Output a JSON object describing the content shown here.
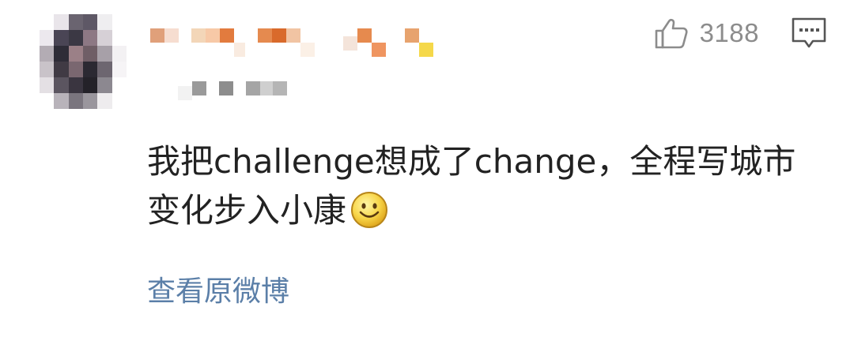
{
  "comment": {
    "text": "我把challenge想成了change，全程写城市变化步入小康",
    "emoji": "smiley-face"
  },
  "actions": {
    "like_count": "3188",
    "like_icon": "thumbs-up-icon",
    "comment_icon": "comment-bubble-icon"
  },
  "footer": {
    "view_original_label": "查看原微博"
  },
  "colors": {
    "like_count": "#8c8c8c",
    "link": "#5b7fa8",
    "text": "#222222"
  }
}
